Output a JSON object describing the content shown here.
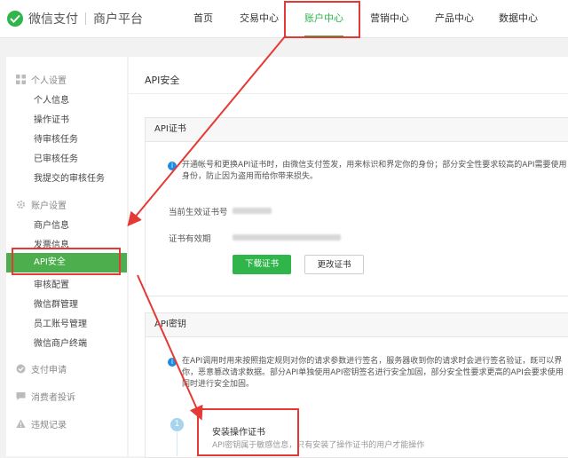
{
  "brand": {
    "name": "微信支付",
    "sub": "商户平台"
  },
  "nav": [
    "首页",
    "交易中心",
    "账户中心",
    "营销中心",
    "产品中心",
    "数据中心"
  ],
  "sidebar": {
    "group1": "个人设置",
    "group1_items": [
      "个人信息",
      "操作证书",
      "待审核任务",
      "已审核任务",
      "我提交的审核任务"
    ],
    "group2": "账户设置",
    "group2_items": [
      "商户信息",
      "发票信息",
      "API安全",
      "审核配置",
      "微信群管理",
      "员工账号管理",
      "微信商户终端"
    ],
    "group3": "支付申请",
    "group4": "消费者投诉",
    "group5": "违规记录"
  },
  "main": {
    "breadcrumb": "API安全",
    "cert": {
      "title": "API证书",
      "notice_line1": "开通帐号和更换API证书时，由微信支付签发，用来标识和界定你的身份；部分安全性要求较高的API需要使用",
      "notice_line2": "身份，防止因为盗用而给你带来损失。",
      "serial_label": "当前生效证书号",
      "validity_label": "证书有效期",
      "download_btn": "下载证书",
      "change_btn": "更改证书"
    },
    "key": {
      "title": "API密钥",
      "notice_line1": "在API调用时用来按照指定规则对你的请求参数进行签名，服务器收到你的请求时会进行签名验证，既可以界",
      "notice_line2": "你，恶意篡改请求数据。部分API单独使用API密钥签名进行安全加固，部分安全性要求更高的API会要求使用",
      "notice_line3": "同时进行安全加固。",
      "step_number": "1",
      "step_title": "安装操作证书",
      "step_desc": "API密钥属于敏感信息，只有安装了操作证书的用户才能操作"
    }
  },
  "colors": {
    "accent": "#2fb54a",
    "annotation": "#e53935"
  }
}
